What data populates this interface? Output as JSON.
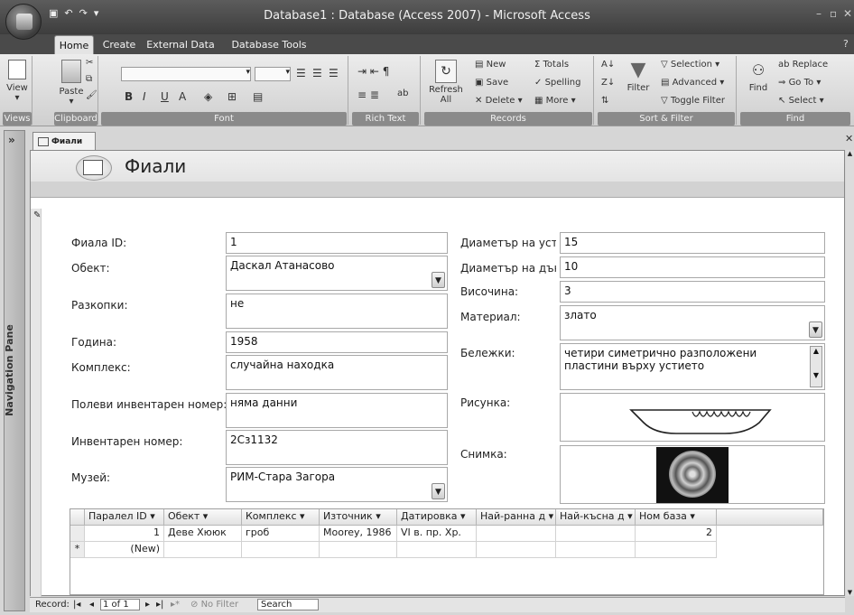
{
  "window": {
    "title": "Database1 : Database (Access 2007) - Microsoft Access"
  },
  "tabs": [
    "Home",
    "Create",
    "External Data",
    "Database Tools"
  ],
  "ribbon": {
    "views": {
      "view_label": "View",
      "group": "Views"
    },
    "clipboard": {
      "paste_label": "Paste",
      "group": "Clipboard"
    },
    "font": {
      "group": "Font",
      "bold": "B",
      "italic": "I",
      "underline": "U",
      "a": "A"
    },
    "rich_text": {
      "group": "Rich Text",
      "ab": "ab"
    },
    "records": {
      "refresh_label": "Refresh All",
      "new": "New",
      "save": "Save",
      "delete": "Delete",
      "totals": "Totals",
      "spelling": "Spelling",
      "more": "More",
      "group": "Records"
    },
    "sort_filter": {
      "filter": "Filter",
      "selection": "Selection",
      "advanced": "Advanced",
      "toggle_filter": "Toggle Filter",
      "group": "Sort & Filter"
    },
    "find": {
      "find": "Find",
      "replace": "Replace",
      "goto": "Go To",
      "select": "Select",
      "group": "Find"
    }
  },
  "nav_pane": {
    "label": "Navigation Pane",
    "collapse": "»"
  },
  "document_tab": {
    "label": "Фиали"
  },
  "form": {
    "title": "Фиали",
    "left_fields": [
      {
        "label": "Фиала ID:",
        "value": "1"
      },
      {
        "label": "Обект:",
        "value": "Даскал Атанасово"
      },
      {
        "label": "Разкопки:",
        "value": "не"
      },
      {
        "label": "Година:",
        "value": "1958"
      },
      {
        "label": "Комплекс:",
        "value": "случайна находка"
      },
      {
        "label": "Полеви инвентарен номер:",
        "value": "няма данни"
      },
      {
        "label": "Инвентарен номер:",
        "value": "2Сз1132"
      },
      {
        "label": "Музей:",
        "value": "РИМ-Стара Загора"
      }
    ],
    "right_fields": [
      {
        "label": "Диаметър на усти",
        "value": "15"
      },
      {
        "label": "Диаметър на дънс",
        "value": "10"
      },
      {
        "label": "Височина:",
        "value": "3"
      },
      {
        "label": "Материал:",
        "value": "злато"
      },
      {
        "label": "Бележки:",
        "value": "четири симетрично разположени пластини върху устието"
      },
      {
        "label": "Рисунка:",
        "value": ""
      },
      {
        "label": "Снимка:",
        "value": ""
      }
    ]
  },
  "subform": {
    "columns": [
      "Паралел ID",
      "Обект",
      "Комплекс",
      "Източник",
      "Датировка",
      "Най-ранна д",
      "Най-късна д",
      "Ном база"
    ],
    "rows": [
      [
        "1",
        "Деве Хююк",
        "гроб",
        "Moorey, 1986",
        "VI в. пр. Хр.",
        "",
        "",
        "2"
      ]
    ],
    "new_row_label": "(New)",
    "new_row_marker": "*"
  },
  "status": {
    "record_label": "Record:",
    "record_value": "1 of 1",
    "no_filter": "No Filter",
    "search": "Search"
  }
}
